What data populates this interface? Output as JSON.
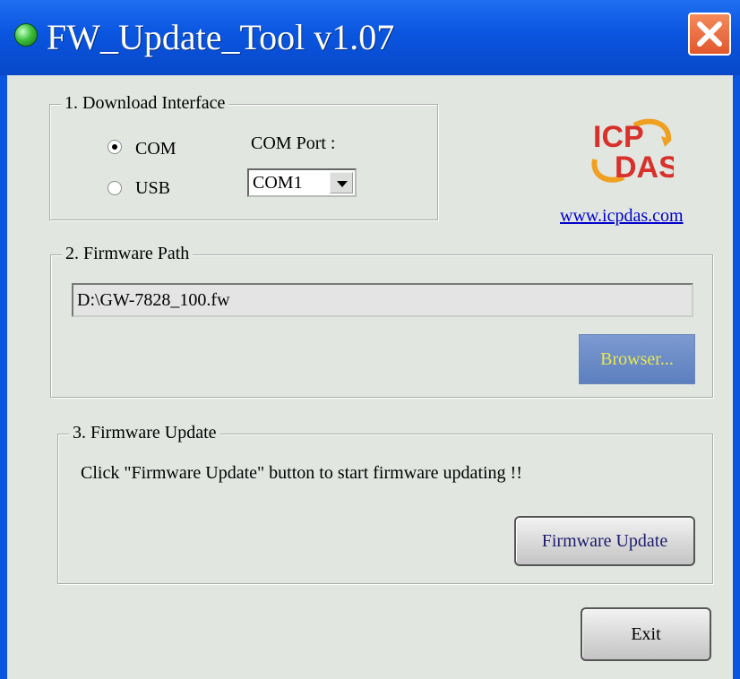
{
  "window": {
    "title": "FW_Update_Tool v1.07",
    "icon": "app-globe-icon",
    "close_icon": "close-icon"
  },
  "download_interface": {
    "legend": "1. Download Interface",
    "options": [
      {
        "label": "COM",
        "checked": true
      },
      {
        "label": "USB",
        "checked": false
      }
    ],
    "com_port_label": "COM Port :",
    "com_port_value": "COM1"
  },
  "brand": {
    "logo_top": "ICP",
    "logo_bottom": "DAS",
    "link": "www.icpdas.com"
  },
  "firmware_path": {
    "legend": "2. Firmware Path",
    "value": "D:\\GW-7828_100.fw",
    "browse_label": "Browser..."
  },
  "firmware_update": {
    "legend": "3. Firmware Update",
    "description": "Click  \"Firmware Update\" button to start firmware updating !!",
    "button_label": "Firmware Update"
  },
  "exit_label": "Exit",
  "colors": {
    "titlebar": "#0a55e0",
    "close_button": "#e2572d",
    "client_bg": "#e1e6e1",
    "browse_button": "#6a8bc8",
    "browse_text": "#e8e84a",
    "link": "#0000cc",
    "logo_red": "#d8302a",
    "logo_orange": "#f0a020"
  }
}
